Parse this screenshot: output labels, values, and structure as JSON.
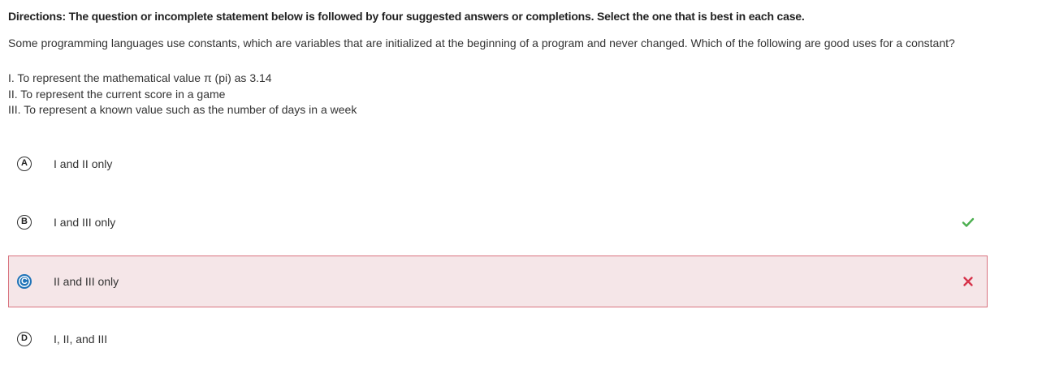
{
  "directions": "Directions: The question or incomplete statement below is followed by four suggested answers or completions. Select the one that is best in each case.",
  "question": "Some programming languages use constants, which are variables that are initialized at the beginning of a program and never changed. Which of the following are good uses for a constant?",
  "statements": [
    "I. To represent the mathematical value π (pi) as 3.14",
    "II. To represent the current score in a game",
    "III. To represent a known value such as the number of days in a week"
  ],
  "choices": [
    {
      "letter": "A",
      "text": "I and II only",
      "state": "none"
    },
    {
      "letter": "B",
      "text": "I and III only",
      "state": "correct"
    },
    {
      "letter": "C",
      "text": "II and III only",
      "state": "selected-incorrect"
    },
    {
      "letter": "D",
      "text": "I, II, and III",
      "state": "none"
    }
  ],
  "colors": {
    "correct": "#4caf50",
    "incorrect": "#d6334a",
    "selected_badge": "#1f73b8",
    "incorrect_bg": "#f5e6e8",
    "incorrect_border": "#d9737f"
  },
  "icons": {
    "correct": "check-icon",
    "incorrect": "x-icon"
  }
}
